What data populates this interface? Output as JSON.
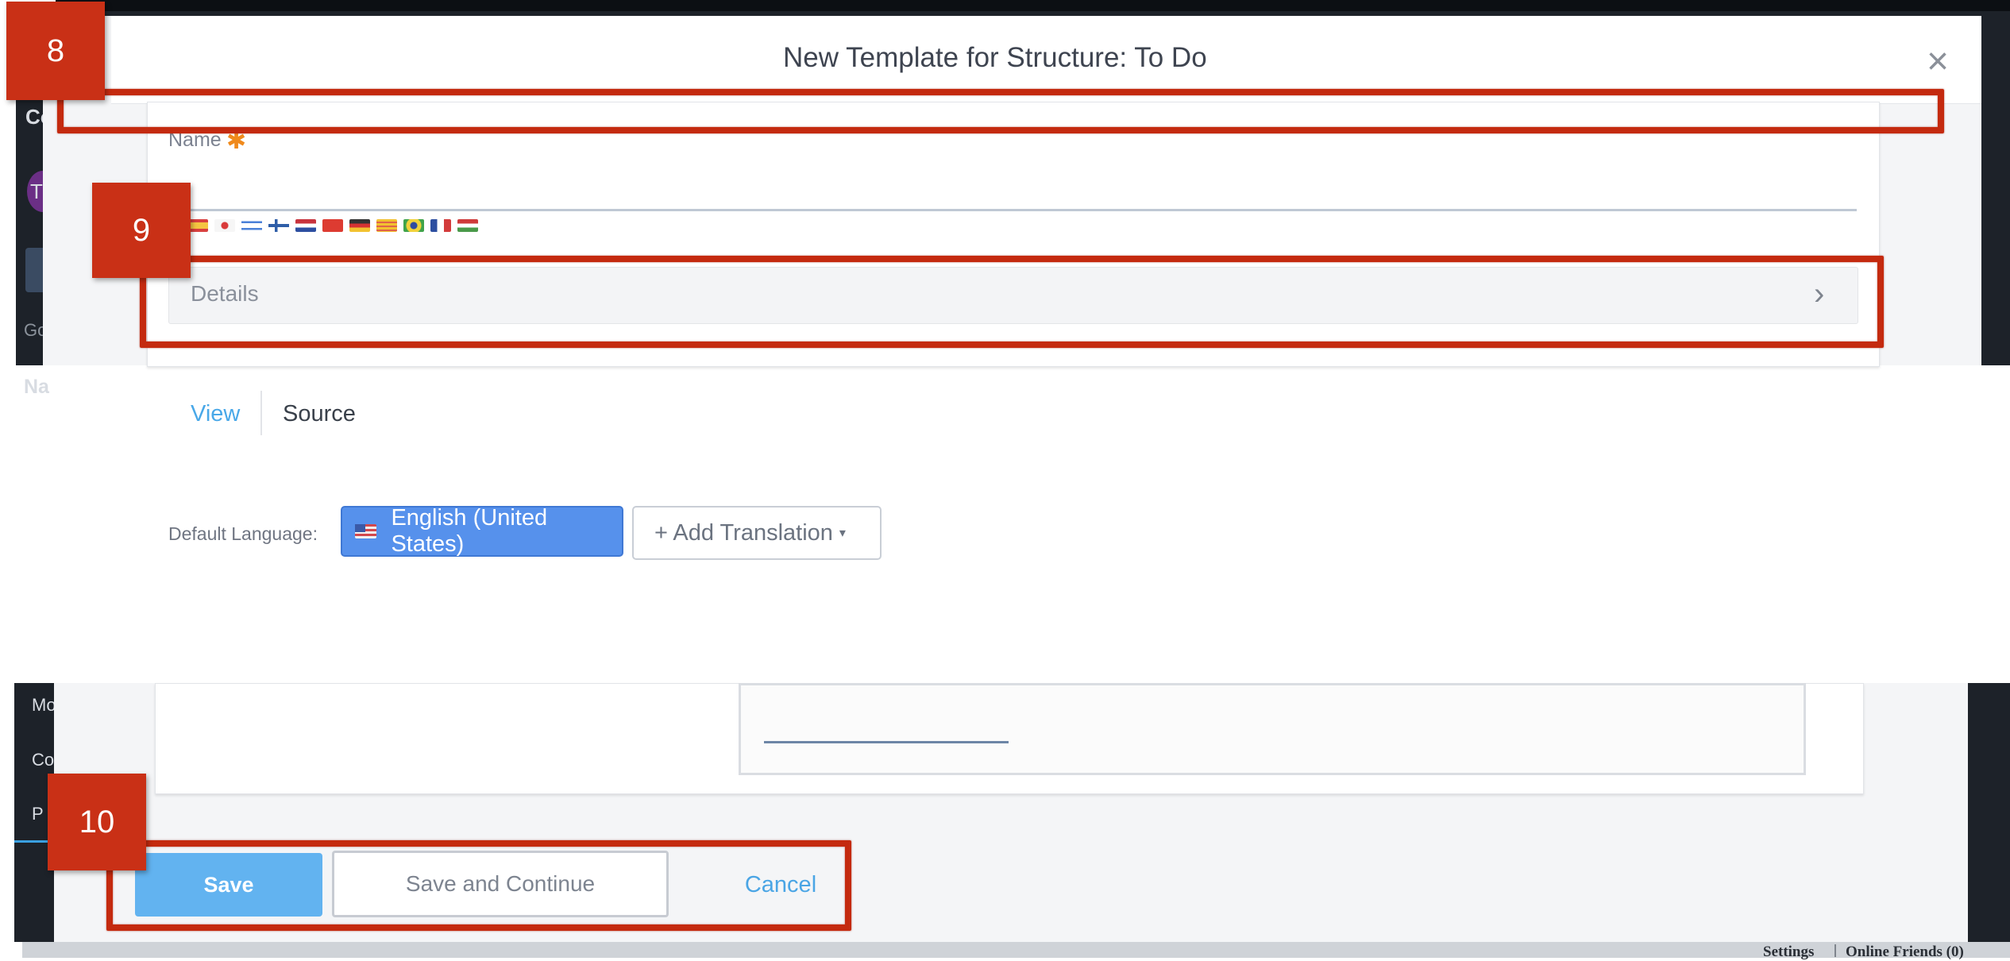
{
  "modal": {
    "title": "New Template for Structure: To Do",
    "close_symbol": "×",
    "name_label": "Name",
    "required_marker": "✱",
    "language_flags": [
      "es",
      "jp",
      "il",
      "fi",
      "nl",
      "cn",
      "de",
      "ca",
      "br",
      "fr",
      "hu"
    ],
    "details_label": "Details",
    "details_chevron": "›",
    "tabs": [
      {
        "label": "View",
        "active": true
      },
      {
        "label": "Source",
        "active": false
      }
    ],
    "default_language_label": "Default Language:",
    "default_language_value": "English (United States)",
    "add_translation_label": "+ Add Translation",
    "add_translation_caret": "▾"
  },
  "footer": {
    "save_label": "Save",
    "save_continue_label": "Save and Continue",
    "cancel_label": "Cancel"
  },
  "background_app": {
    "sidebar_fragments": [
      "Co",
      "Go",
      "Na",
      "Mo",
      "Co",
      "P"
    ],
    "avatar_letter": "T",
    "bottom_links": [
      "Settings",
      "Online Friends (0)"
    ]
  },
  "annotations": {
    "callouts": [
      "8",
      "9",
      "10"
    ]
  },
  "colors": {
    "annotation_red": "#c42a0f",
    "primary_blue": "#5691ec",
    "save_blue": "#62b3f0",
    "link_blue": "#49a8e8",
    "required_orange": "#f08a1c",
    "app_dark": "#1d2229"
  }
}
